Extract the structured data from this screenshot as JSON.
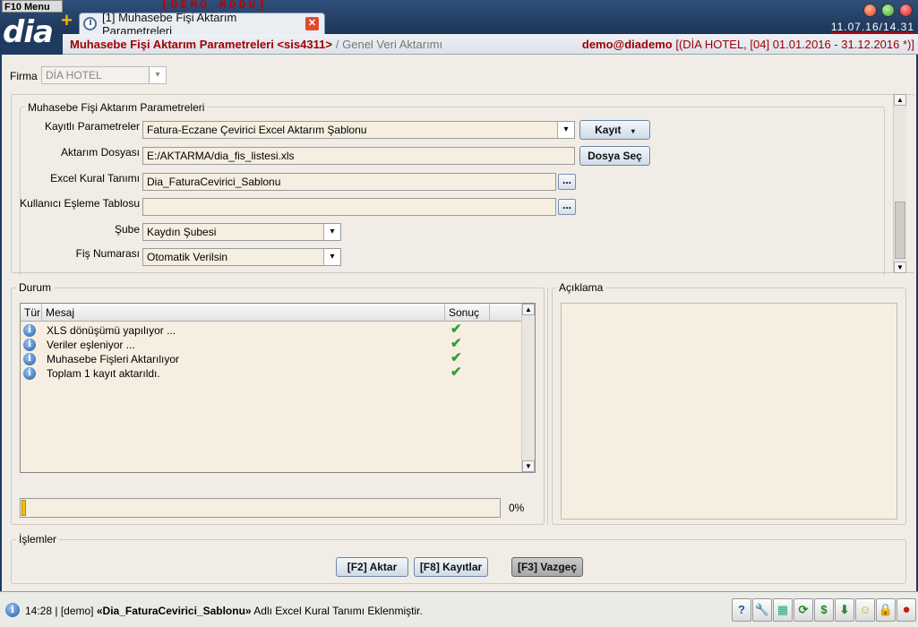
{
  "app": {
    "menu_label": "F10 Menu",
    "logo": "dia",
    "demo_mode": "[DEMO MODU]",
    "datetime": "11.07.16/14.31"
  },
  "tab": {
    "label": "[1] Muhasebe Fişi Aktarım Parametreleri",
    "close": "✕"
  },
  "header": {
    "title": "Muhasebe Fişi Aktarım Parametreleri <sis4311>",
    "breadcrumb": "/ Genel Veri Aktarımı",
    "user": "demo@diademo",
    "context": "[(DİA HOTEL, [04] 01.01.2016 - 31.12.2016 *)]"
  },
  "firma": {
    "label": "Firma",
    "value": "DİA HOTEL"
  },
  "params": {
    "group_title": "Muhasebe Fişi Aktarım Parametreleri",
    "kayitli_label": "Kayıtlı Parametreler",
    "kayitli_value": "Fatura-Eczane Çevirici Excel Aktarım Şablonu",
    "kayit_button": "Kayıt",
    "dosya_label": "Aktarım Dosyası",
    "dosya_value": "E:/AKTARMA/dia_fis_listesi.xls",
    "dosya_button": "Dosya Seç",
    "kural_label": "Excel Kural Tanımı",
    "kural_value": "Dia_FaturaCevirici_Sablonu",
    "esleme_label": "Kullanıcı Eşleme Tablosu",
    "esleme_value": "",
    "sube_label": "Şube",
    "sube_value": "Kaydın Şubesi",
    "fisno_label": "Fiş Numarası",
    "fisno_value": "Otomatik Verilsin",
    "dots": "..."
  },
  "durum": {
    "title": "Durum",
    "columns": {
      "tur": "Tür",
      "mesaj": "Mesaj",
      "sonuc": "Sonuç"
    },
    "rows": [
      {
        "mesaj": "XLS dönüşümü yapılıyor ..."
      },
      {
        "mesaj": "Veriler eşleniyor ..."
      },
      {
        "mesaj": "Muhasebe Fişleri Aktarılıyor"
      },
      {
        "mesaj": "Toplam 1 kayıt aktarıldı."
      }
    ],
    "progress_fraction": 0.01,
    "progress_text": "0%"
  },
  "aciklama": {
    "title": "Açıklama"
  },
  "islemler": {
    "title": "İşlemler",
    "aktar": "[F2] Aktar",
    "kayitlar": "[F8] Kayıtlar",
    "vazgec": "[F3] Vazgeç"
  },
  "status": {
    "time": "14:28",
    "user": "[demo]",
    "name": "«Dia_FaturaCevirici_Sablonu»",
    "message": "Adlı Excel Kural Tanımı Eklenmiştir."
  },
  "colors": {
    "accent": "#a00000",
    "check": "#2fa12f",
    "progress": "#f2c200"
  }
}
